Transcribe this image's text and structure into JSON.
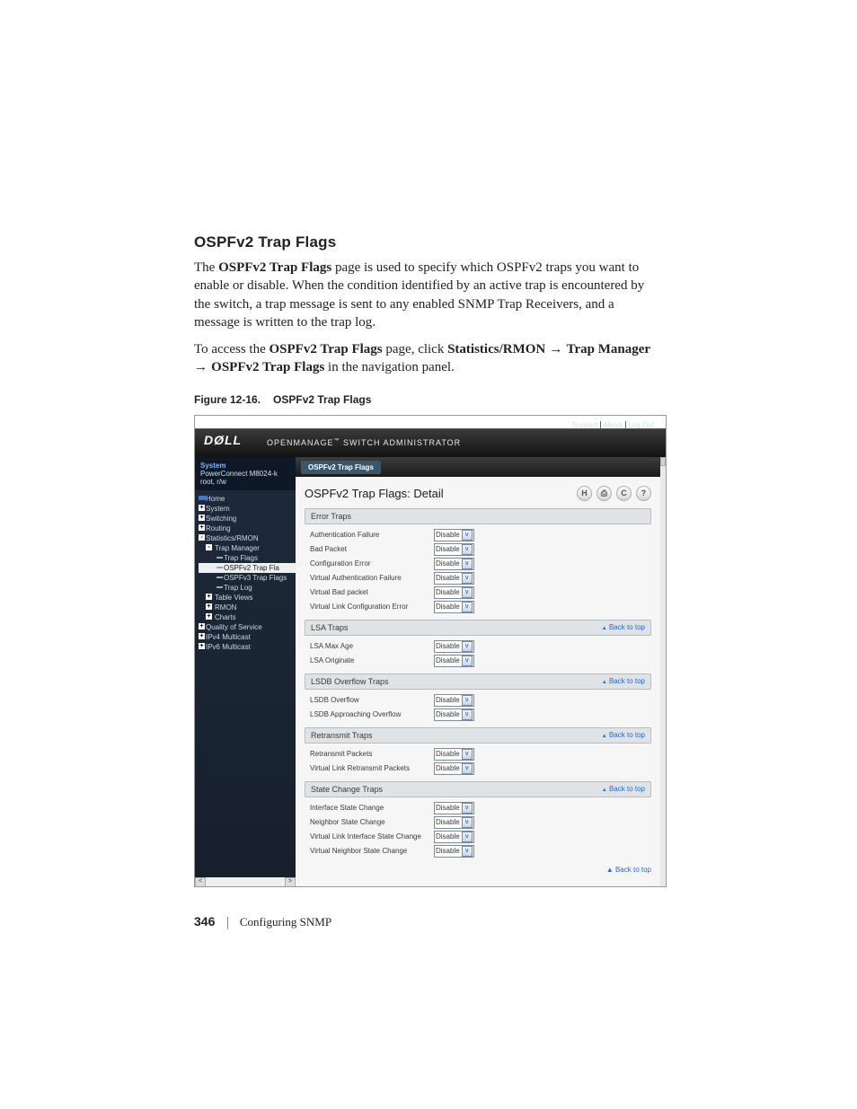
{
  "heading": "OSPFv2 Trap Flags",
  "para1_a": "The ",
  "para1_b": "OSPFv2 Trap Flags",
  "para1_c": " page is used to specify which OSPFv2 traps you want to enable or disable. When the condition identified by an active trap is encountered by the switch, a trap message is sent to any enabled SNMP Trap Receivers, and a message is written to the trap log.",
  "para2_a": "To access the ",
  "para2_b": "OSPFv2 Trap Flags",
  "para2_c": " page, click ",
  "para2_d": "Statistics/RMON",
  "para2_e": "Trap Manager",
  "para2_f": "OSPFv2 Trap Flags",
  "para2_g": " in the navigation panel.",
  "arrow": " → ",
  "fig_num": "Figure 12-16.",
  "fig_title": "OSPFv2 Trap Flags",
  "shot": {
    "top_links": [
      "Support",
      "About",
      "Log Out"
    ],
    "logo": "DØLL",
    "suite_a": "OPENMANAGE",
    "suite_b": " SWITCH ADMINISTRATOR",
    "tm": "™",
    "side_system": "System",
    "side_model": "PowerConnect M8024-k",
    "side_user": "root, r/w",
    "tree": [
      {
        "lvl": 1,
        "type": "bar",
        "label": "Home"
      },
      {
        "lvl": 1,
        "type": "box",
        "sym": "+",
        "label": "System"
      },
      {
        "lvl": 1,
        "type": "box",
        "sym": "+",
        "label": "Switching"
      },
      {
        "lvl": 1,
        "type": "box",
        "sym": "+",
        "label": "Routing"
      },
      {
        "lvl": 1,
        "type": "box",
        "sym": "-",
        "label": "Statistics/RMON"
      },
      {
        "lvl": 2,
        "type": "box",
        "sym": "-",
        "label": "Trap Manager"
      },
      {
        "lvl": 3,
        "type": "dash",
        "label": "Trap Flags"
      },
      {
        "lvl": 3,
        "type": "dash",
        "label": "OSPFv2 Trap Fla",
        "sel": true
      },
      {
        "lvl": 3,
        "type": "dash",
        "label": "OSPFv3 Trap Flags"
      },
      {
        "lvl": 3,
        "type": "dash",
        "label": "Trap Log"
      },
      {
        "lvl": 2,
        "type": "box",
        "sym": "+",
        "label": "Table Views"
      },
      {
        "lvl": 2,
        "type": "box",
        "sym": "+",
        "label": "RMON"
      },
      {
        "lvl": 2,
        "type": "box",
        "sym": "+",
        "label": "Charts"
      },
      {
        "lvl": 1,
        "type": "box",
        "sym": "+",
        "label": "Quality of Service"
      },
      {
        "lvl": 1,
        "type": "box",
        "sym": "+",
        "label": "IPv4 Multicast"
      },
      {
        "lvl": 1,
        "type": "box",
        "sym": "+",
        "label": "IPv6 Multicast"
      }
    ],
    "crumb": "OSPFv2 Trap Flags",
    "page_title": "OSPFv2 Trap Flags: Detail",
    "icons": [
      "save-icon",
      "print-icon",
      "refresh-icon",
      "help-icon"
    ],
    "icon_glyphs": {
      "save-icon": "H",
      "print-icon": "⎙",
      "refresh-icon": "C",
      "help-icon": "?"
    },
    "back": "Back to top",
    "select_value": "Disable",
    "sections": [
      {
        "title": "Error Traps",
        "back": false,
        "rows": [
          "Authentication Failure",
          "Bad Packet",
          "Configuration Error",
          "Virtual Authentication Failure",
          "Virtual Bad packet",
          "Virtual Link Configuration Error"
        ]
      },
      {
        "title": "LSA Traps",
        "back": true,
        "rows": [
          "LSA Max Age",
          "LSA Originate"
        ]
      },
      {
        "title": "LSDB Overflow Traps",
        "back": true,
        "rows": [
          "LSDB Overflow",
          "LSDB Approaching Overflow"
        ]
      },
      {
        "title": "Retransmit Traps",
        "back": true,
        "rows": [
          "Retransmit Packets",
          "Virtual Link Retransmit Packets"
        ]
      },
      {
        "title": "State Change Traps",
        "back": true,
        "rows": [
          "Interface State Change",
          "Neighbor State Change",
          "Virtual Link Interface State Change",
          "Virtual Neighbor State Change"
        ]
      }
    ]
  },
  "footer_page": "346",
  "footer_chapter": "Configuring SNMP"
}
